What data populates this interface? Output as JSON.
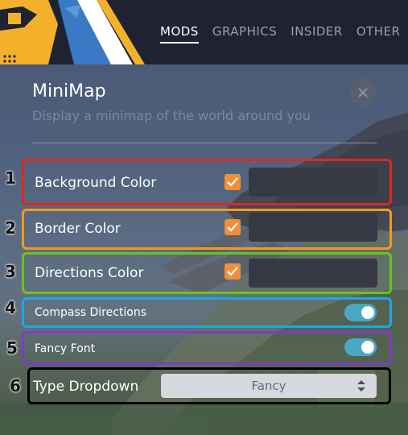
{
  "nav": {
    "tabs": [
      {
        "label": "MODS",
        "active": true
      },
      {
        "label": "GRAPHICS",
        "active": false
      },
      {
        "label": "INSIDER",
        "active": false
      },
      {
        "label": "OTHER",
        "active": false
      }
    ]
  },
  "panel": {
    "title": "MiniMap",
    "subtitle": "Display a minimap of the world around you",
    "close_icon": "close-icon"
  },
  "settings": [
    {
      "number": "1",
      "label": "Background Color",
      "control": "checkbox+color",
      "checked": true,
      "outline_color": "#e0271d"
    },
    {
      "number": "2",
      "label": "Border Color",
      "control": "checkbox+color",
      "checked": true,
      "outline_color": "#f39a1b"
    },
    {
      "number": "3",
      "label": "Directions Color",
      "control": "checkbox+color",
      "checked": true,
      "outline_color": "#6cc21d"
    },
    {
      "number": "4",
      "label": "Compass Directions",
      "control": "toggle",
      "on": true,
      "outline_color": "#1da7e6"
    },
    {
      "number": "5",
      "label": "Fancy Font",
      "control": "toggle",
      "on": true,
      "outline_color": "#7d3cc8"
    },
    {
      "number": "6",
      "label": "Type Dropdown",
      "control": "dropdown",
      "value": "Fancy",
      "outline_color": "#000000"
    }
  ],
  "colors": {
    "accent_orange": "#ef8f3a",
    "toggle_on": "#4aa7c4",
    "swatch": "#363944",
    "topbar": "#1f2230"
  }
}
